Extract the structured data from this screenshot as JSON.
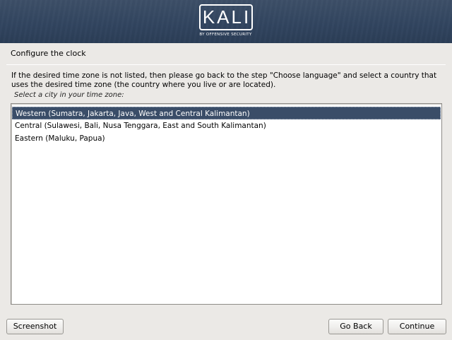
{
  "banner": {
    "logo_text": "KALI",
    "logo_subtitle": "BY OFFENSIVE SECURITY"
  },
  "step": {
    "title": "Configure the clock"
  },
  "main": {
    "description": "If the desired time zone is not listed, then please go back to the step \"Choose language\" and select a country that uses the desired time zone (the country where you live or are located).",
    "prompt": "Select a city in your time zone:",
    "selected_index": 0,
    "options": [
      {
        "label": "Western (Sumatra, Jakarta, Java, West and Central Kalimantan)"
      },
      {
        "label": "Central (Sulawesi, Bali, Nusa Tenggara, East and South Kalimantan)"
      },
      {
        "label": "Eastern (Maluku, Papua)"
      }
    ]
  },
  "buttons": {
    "screenshot": "Screenshot",
    "back": "Go Back",
    "continue": "Continue"
  },
  "colors": {
    "banner": "#324560",
    "selection": "#3a4d68",
    "background": "#ebe9e6"
  }
}
